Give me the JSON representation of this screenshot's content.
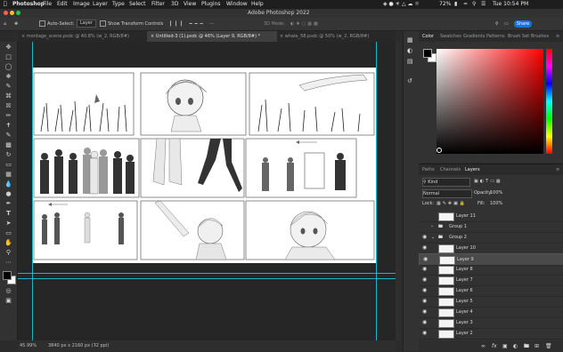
{
  "menubar": {
    "apple": "",
    "app": "Photoshop",
    "items": [
      "File",
      "Edit",
      "Image",
      "Layer",
      "Type",
      "Select",
      "Filter",
      "3D",
      "View",
      "Plugins",
      "Window",
      "Help"
    ],
    "battery": "72%",
    "clock": "Tue 10:54 PM"
  },
  "titlebar": {
    "title": "Adobe Photoshop 2022"
  },
  "options": {
    "auto_select_label": "Auto-Select:",
    "auto_select_value": "Layer",
    "transform_label": "Show Transform Controls",
    "mode_3d": "3D Mode:",
    "share_label": "Share"
  },
  "tabs": [
    {
      "label": "montage_scene.psdc @ 40.8% (w_2, RGB/8#)"
    },
    {
      "label": "Untitled-3 (1).psdc @ 46% (Layer 9, RGB/8#) *"
    },
    {
      "label": "whale_58.psdc @ 50% (w_2, RGB/8#)"
    }
  ],
  "status": {
    "zoom": "45.99%",
    "size": "3840 px x 2160 px (72 ppi)"
  },
  "color_panel": {
    "tabs": [
      "Color",
      "Swatches",
      "Gradients",
      "Patterns",
      "Brush Set",
      "Brushes"
    ],
    "foreground": "#000000",
    "background": "#ffffff"
  },
  "layers_panel": {
    "tabs": [
      "Paths",
      "Channels",
      "Layers"
    ],
    "filter_kind": "Kind",
    "blend_mode": "Normal",
    "opacity_label": "Opacity:",
    "opacity": "100%",
    "lock_label": "Lock:",
    "fill_label": "Fill:",
    "fill": "100%",
    "layers": [
      {
        "name": "Layer 11",
        "visible": false,
        "type": "layer"
      },
      {
        "name": "Group 1",
        "visible": false,
        "type": "group"
      },
      {
        "name": "Group 2",
        "visible": true,
        "type": "group"
      },
      {
        "name": "Layer 10",
        "visible": true,
        "type": "layer"
      },
      {
        "name": "Layer 9",
        "visible": true,
        "type": "layer",
        "selected": true
      },
      {
        "name": "Layer 8",
        "visible": true,
        "type": "layer"
      },
      {
        "name": "Layer 7",
        "visible": true,
        "type": "layer"
      },
      {
        "name": "Layer 6",
        "visible": true,
        "type": "layer"
      },
      {
        "name": "Layer 5",
        "visible": true,
        "type": "layer"
      },
      {
        "name": "Layer 4",
        "visible": true,
        "type": "layer"
      },
      {
        "name": "Layer 3",
        "visible": true,
        "type": "layer"
      },
      {
        "name": "Layer 2",
        "visible": true,
        "type": "layer"
      }
    ],
    "footer_icons": [
      "link-icon",
      "fx-icon",
      "mask-icon",
      "adjustment-icon",
      "folder-icon",
      "new-layer-icon",
      "trash-icon"
    ]
  }
}
